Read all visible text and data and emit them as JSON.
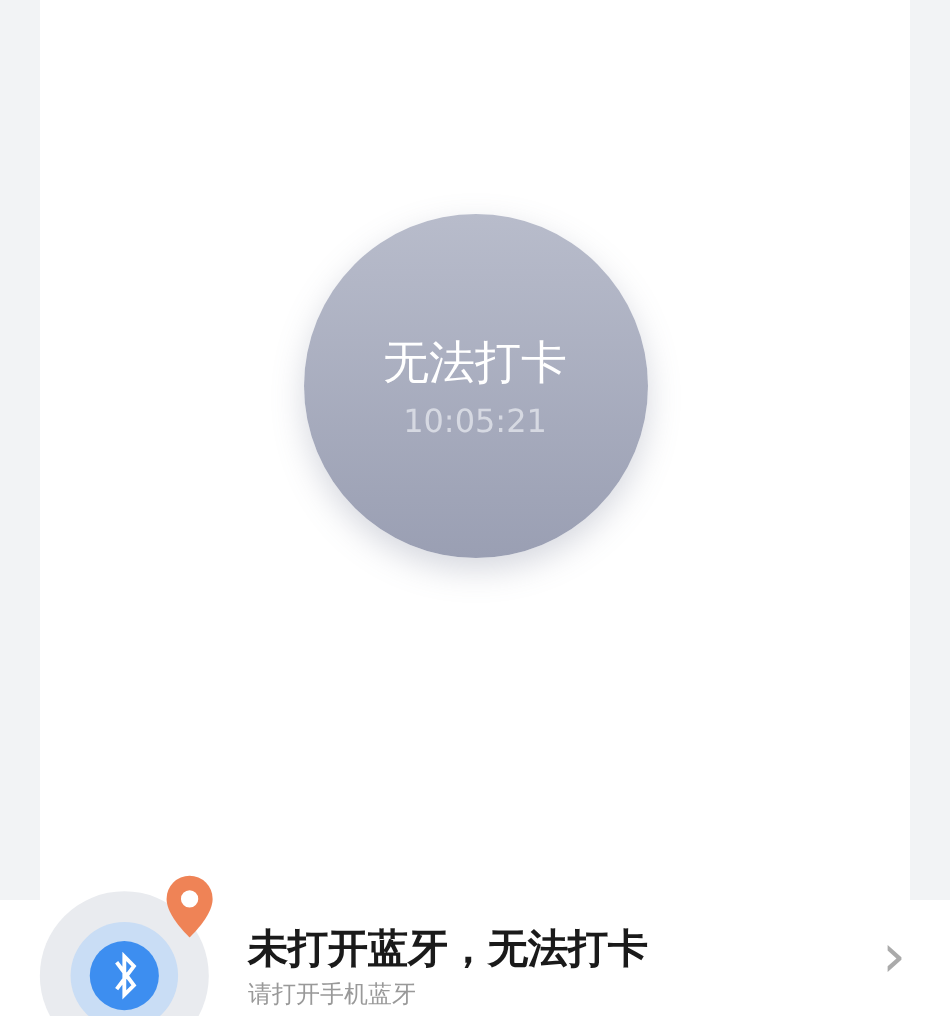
{
  "punch_button": {
    "label": "无法打卡",
    "time": "10:05:21"
  },
  "status_bar": {
    "title": "未打开蓝牙，无法打卡",
    "subtitle": "请打开手机蓝牙",
    "chevron": "›"
  }
}
